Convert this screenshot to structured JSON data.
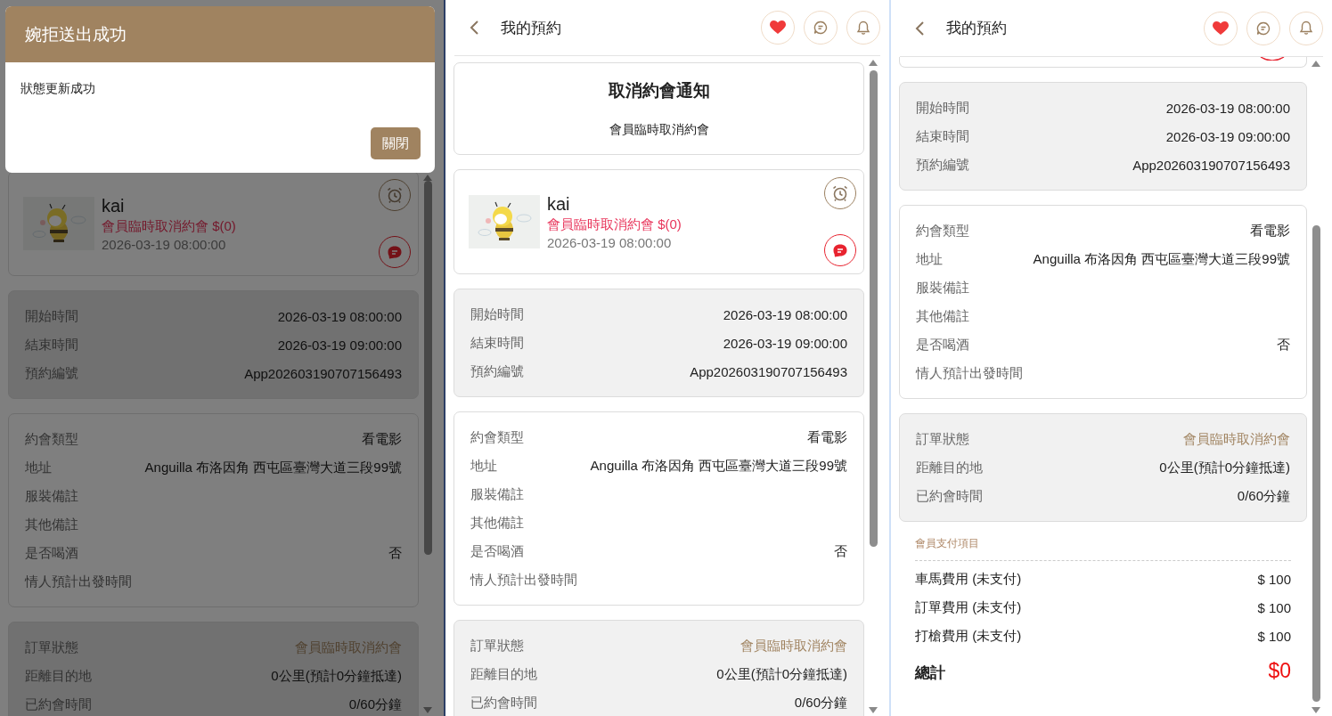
{
  "dialog": {
    "title": "婉拒送出成功",
    "message": "狀態更新成功",
    "button": "關閉"
  },
  "panels": [
    {
      "dimmed": true,
      "sections": [
        {
          "kind": "profile",
          "name": "kai",
          "status": "會員臨時取消約會 $(0)",
          "time": "2026-03-19 08:00:00"
        },
        {
          "kind": "details",
          "shaded": true,
          "rows": [
            {
              "label": "開始時間",
              "value": "2026-03-19 08:00:00"
            },
            {
              "label": "結束時間",
              "value": "2026-03-19 09:00:00"
            },
            {
              "label": "預約編號",
              "value": "App202603190707156493"
            }
          ]
        },
        {
          "kind": "details",
          "shaded": false,
          "rows": [
            {
              "label": "約會類型",
              "value": "看電影"
            },
            {
              "label": "地址",
              "value": "Anguilla 布洛因角 西屯區臺灣大道三段99號"
            },
            {
              "label": "服裝備註"
            },
            {
              "label": "其他備註"
            },
            {
              "label": "是否喝酒",
              "value": "否"
            },
            {
              "label": "情人預計出發時間"
            }
          ]
        },
        {
          "kind": "details",
          "shaded": true,
          "rows": [
            {
              "label": "訂單狀態",
              "value": "會員臨時取消約會",
              "accent": true
            },
            {
              "label": "距離目的地",
              "value": "0公里(預計0分鐘抵達)"
            },
            {
              "label": "已約會時間",
              "value": "0/60分鐘"
            }
          ]
        }
      ]
    },
    {
      "dimmed": false,
      "header": {
        "title": "我的預約"
      },
      "sections": [
        {
          "kind": "notice",
          "title": "取消約會通知",
          "message": "會員臨時取消約會"
        },
        {
          "kind": "profile",
          "name": "kai",
          "status": "會員臨時取消約會 $(0)",
          "time": "2026-03-19 08:00:00"
        },
        {
          "kind": "details",
          "shaded": true,
          "rows": [
            {
              "label": "開始時間",
              "value": "2026-03-19 08:00:00"
            },
            {
              "label": "結束時間",
              "value": "2026-03-19 09:00:00"
            },
            {
              "label": "預約編號",
              "value": "App202603190707156493"
            }
          ]
        },
        {
          "kind": "details",
          "shaded": false,
          "rows": [
            {
              "label": "約會類型",
              "value": "看電影"
            },
            {
              "label": "地址",
              "value": "Anguilla 布洛因角 西屯區臺灣大道三段99號"
            },
            {
              "label": "服裝備註"
            },
            {
              "label": "其他備註"
            },
            {
              "label": "是否喝酒",
              "value": "否"
            },
            {
              "label": "情人預計出發時間"
            }
          ]
        },
        {
          "kind": "details",
          "shaded": true,
          "rows": [
            {
              "label": "訂單狀態",
              "value": "會員臨時取消約會",
              "accent": true
            },
            {
              "label": "距離目的地",
              "value": "0公里(預計0分鐘抵達)"
            },
            {
              "label": "已約會時間",
              "value": "0/60分鐘"
            }
          ]
        }
      ]
    },
    {
      "dimmed": false,
      "header": {
        "title": "我的預約"
      },
      "sections": [
        {
          "kind": "card_end"
        },
        {
          "kind": "details",
          "shaded": true,
          "rows": [
            {
              "label": "開始時間",
              "value": "2026-03-19 08:00:00"
            },
            {
              "label": "結束時間",
              "value": "2026-03-19 09:00:00"
            },
            {
              "label": "預約編號",
              "value": "App202603190707156493"
            }
          ]
        },
        {
          "kind": "details",
          "shaded": false,
          "rows": [
            {
              "label": "約會類型",
              "value": "看電影"
            },
            {
              "label": "地址",
              "value": "Anguilla 布洛因角 西屯區臺灣大道三段99號"
            },
            {
              "label": "服裝備註"
            },
            {
              "label": "其他備註"
            },
            {
              "label": "是否喝酒",
              "value": "否"
            },
            {
              "label": "情人預計出發時間"
            }
          ]
        },
        {
          "kind": "details",
          "shaded": true,
          "rows": [
            {
              "label": "訂單狀態",
              "value": "會員臨時取消約會",
              "accent": true
            },
            {
              "label": "距離目的地",
              "value": "0公里(預計0分鐘抵達)"
            },
            {
              "label": "已約會時間",
              "value": "0/60分鐘"
            }
          ]
        },
        {
          "kind": "payments",
          "title": "會員支付項目",
          "items": [
            {
              "label": "車馬費用 (未支付)",
              "amount": "$ 100"
            },
            {
              "label": "訂單費用 (未支付)",
              "amount": "$ 100"
            },
            {
              "label": "打槍費用 (未支付)",
              "amount": "$ 100"
            }
          ],
          "total_label": "總計",
          "total": "$0"
        }
      ]
    }
  ]
}
